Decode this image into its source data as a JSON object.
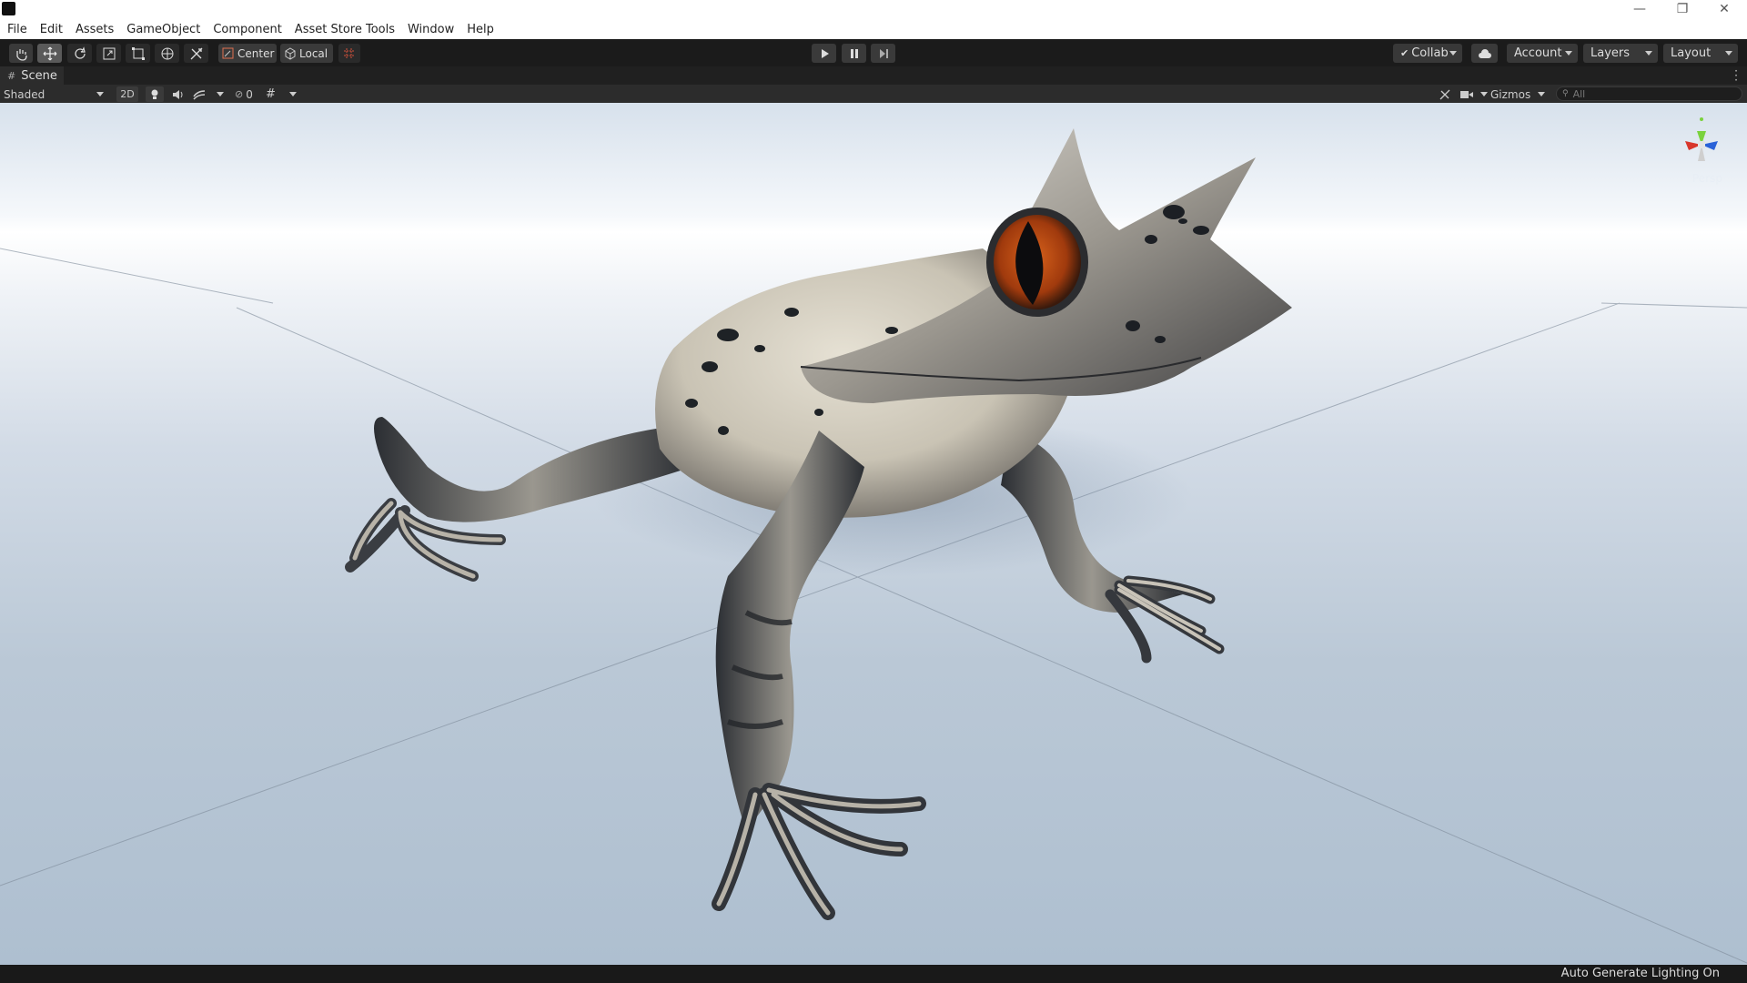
{
  "menu": [
    "File",
    "Edit",
    "Assets",
    "GameObject",
    "Component",
    "Asset Store Tools",
    "Window",
    "Help"
  ],
  "window_controls": {
    "minimize": "—",
    "restore": "❐",
    "close": "✕"
  },
  "toolbar": {
    "pivot_mode": "Center",
    "pivot_rotation": "Local",
    "collab": "Collab",
    "account": "Account",
    "layers": "Layers",
    "layout": "Layout"
  },
  "scene": {
    "tab_title": "Scene",
    "shading_mode": "Shaded",
    "mode_2d": "2D",
    "hidden_count": "0",
    "gizmos": "Gizmos",
    "search_placeholder": "All",
    "projection": "Persp"
  },
  "status": {
    "message": "Auto Generate Lighting On"
  },
  "colors": {
    "toolbar_bg": "#1b1b1b",
    "scenebar_bg": "#2c2c2c",
    "skin_light": "#d8d2c2",
    "skin_dark": "#2a2e33",
    "eye": "#b4400f"
  }
}
